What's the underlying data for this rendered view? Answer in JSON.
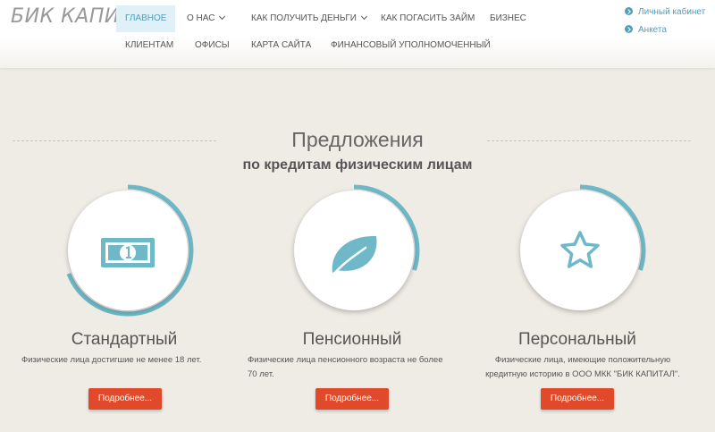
{
  "header": {
    "logo": "БИК КАПИТАЛ",
    "nav": {
      "home": "ГЛАВНОЕ",
      "about": "О НАС",
      "get_money": "КАК ПОЛУЧИТЬ ДЕНЬГИ",
      "repay": "КАК ПОГАСИТЬ ЗАЙМ",
      "business": "БИЗНЕС",
      "clients": "КЛИЕНТАМ",
      "offices": "ОФИСЫ",
      "sitemap": "КАРТА САЙТА",
      "ombudsman": "ФИНАНСОВЫЙ УПОЛНОМОЧЕННЫЙ"
    },
    "user_links": {
      "cabinet": "Личный кабинет",
      "form": "Анкета"
    }
  },
  "offers": {
    "title": "Предложения",
    "subtitle": "по кредитам физическим лицам",
    "accent_color": "#6fb8c8",
    "button_color": "#e04a2b",
    "cards": [
      {
        "icon": "banknote-icon",
        "title": "Стандартный",
        "desc": [
          "Физические лица достигшие не менее 18 лет."
        ],
        "button": "Подробнее...",
        "ring_fill": 0.69
      },
      {
        "icon": "leaf-icon",
        "title": "Пенсионный",
        "desc": [
          "Физические лица пенсионного возраста не более",
          "70 лет."
        ],
        "button": "Подробнее...",
        "ring_fill": 0.3
      },
      {
        "icon": "star-icon",
        "title": "Персональный",
        "desc": [
          "Физические лица, имеющие положительную",
          "кредитную историю в ООО МКК \"БИК КАПИТАЛ\"."
        ],
        "button": "Подробнее...",
        "ring_fill": 0.3
      }
    ]
  }
}
